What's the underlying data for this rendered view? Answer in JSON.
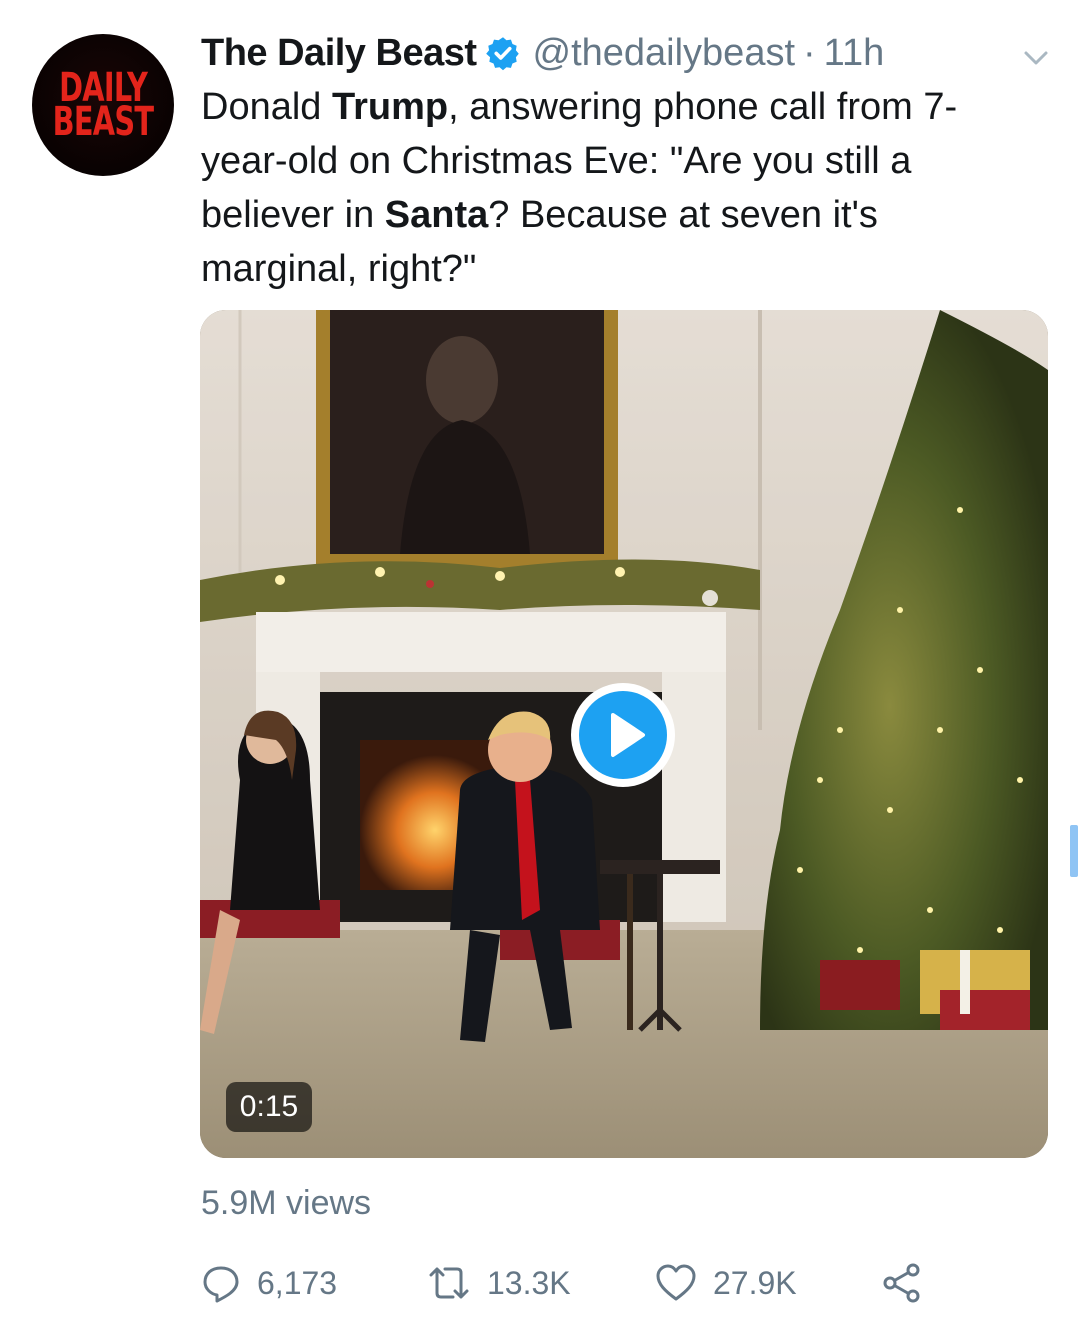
{
  "avatar": {
    "line1": "DAILY",
    "line2": "BEAST",
    "brand_color": "#e3241b"
  },
  "tweet": {
    "author_name": "The Daily Beast",
    "handle": "@thedailybeast",
    "separator": "·",
    "time": "11h",
    "verified_icon": "verified-badge-icon",
    "text_parts": [
      "Donald ",
      "Trump",
      ", answering phone call from 7-year-old on Christmas Eve: \"Are you still a believer in ",
      "Santa",
      "? Because at seven it's marginal, right?\""
    ]
  },
  "media": {
    "duration": "0:15",
    "play_icon": "play-icon"
  },
  "views": "5.9M views",
  "actions": {
    "reply_count": "6,173",
    "retweet_count": "13.3K",
    "like_count": "27.9K"
  },
  "colors": {
    "accent": "#1da1f2",
    "muted": "#657786",
    "text": "#14171a"
  }
}
